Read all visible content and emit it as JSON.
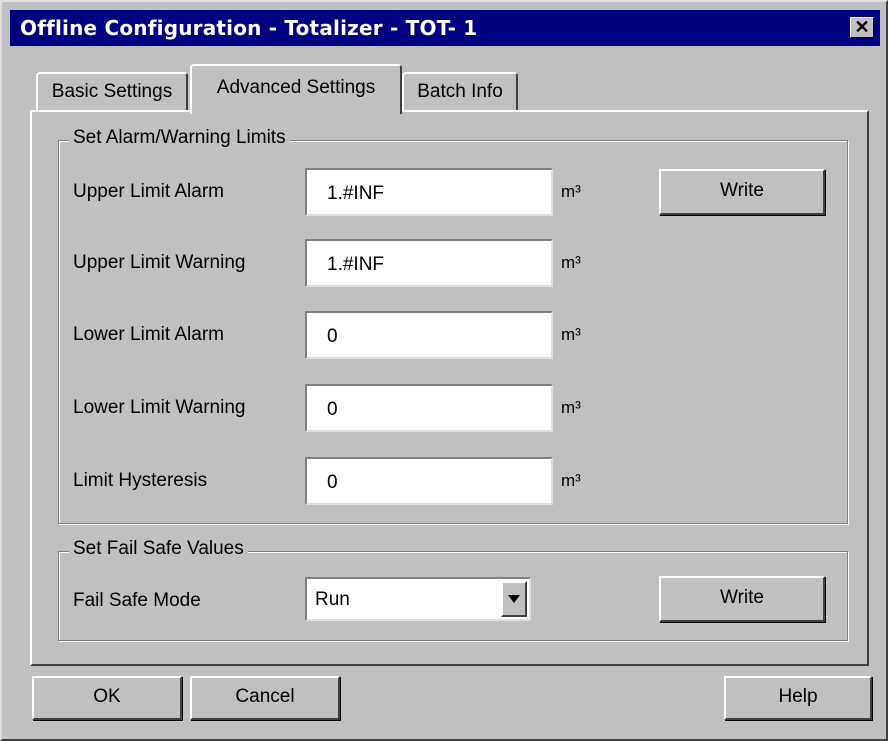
{
  "window": {
    "title": "Offline Configuration - Totalizer - TOT- 1",
    "close_glyph": "✕"
  },
  "tabs": [
    {
      "label": "Basic Settings",
      "active": false
    },
    {
      "label": "Advanced Settings",
      "active": true
    },
    {
      "label": "Batch Info",
      "active": false
    }
  ],
  "alarm_group": {
    "title": "Set Alarm/Warning Limits",
    "rows": [
      {
        "label": "Upper Limit Alarm",
        "value": "1.#INF",
        "unit": "m³"
      },
      {
        "label": "Upper Limit Warning",
        "value": "1.#INF",
        "unit": "m³"
      },
      {
        "label": "Lower Limit Alarm",
        "value": "0",
        "unit": "m³"
      },
      {
        "label": "Lower Limit Warning",
        "value": "0",
        "unit": "m³"
      },
      {
        "label": "Limit Hysteresis",
        "value": "0",
        "unit": "m³"
      }
    ],
    "write_label": "Write"
  },
  "failsafe_group": {
    "title": "Set Fail Safe Values",
    "mode_label": "Fail Safe Mode",
    "mode_value": "Run",
    "write_label": "Write"
  },
  "footer": {
    "ok_label": "OK",
    "cancel_label": "Cancel",
    "help_label": "Help"
  },
  "icons": {
    "close": "close-icon",
    "dropdown": "chevron-down-icon"
  }
}
